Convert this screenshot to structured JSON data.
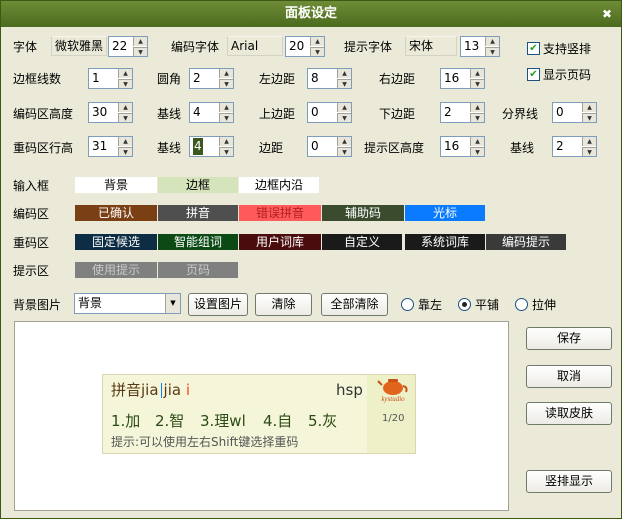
{
  "window": {
    "title": "面板设定"
  },
  "row1": {
    "font_label": "字体",
    "font_value": "微软雅黑",
    "font_size": "22",
    "code_font_label": "编码字体",
    "code_font_value": "Arial",
    "code_font_size": "20",
    "tip_font_label": "提示字体",
    "tip_font_value": "宋体",
    "tip_font_size": "13",
    "vertical_label": "支持竖排",
    "pagenum_label": "显示页码"
  },
  "row2": {
    "border_lines_label": "边框线数",
    "border_lines": "1",
    "corner_label": "圆角",
    "corner": "2",
    "left_margin_label": "左边距",
    "left_margin": "8",
    "right_margin_label": "右边距",
    "right_margin": "16"
  },
  "row3": {
    "code_height_label": "编码区高度",
    "code_height": "30",
    "baseline_label": "基线",
    "baseline": "4",
    "top_margin_label": "上边距",
    "top_margin": "0",
    "bottom_margin_label": "下边距",
    "bottom_margin": "2",
    "divider_label": "分界线",
    "divider": "0"
  },
  "row4": {
    "cand_row_height_label": "重码区行高",
    "cand_row_height": "31",
    "baseline_label": "基线",
    "baseline": "4",
    "margin_label": "边距",
    "margin": "0",
    "tip_height_label": "提示区高度",
    "tip_height": "16",
    "tip_baseline_label": "基线",
    "tip_baseline": "2"
  },
  "colors": {
    "input_label": "输入框",
    "input": [
      "背景",
      "边框",
      "边框内沿"
    ],
    "code_label": "编码区",
    "code": [
      "已确认",
      "拼音",
      "错误拼音",
      "辅助码",
      "光标"
    ],
    "cand_label": "重码区",
    "cand": [
      "固定候选",
      "智能组词",
      "用户词库",
      "自定义",
      "系统词库",
      "编码提示"
    ],
    "tip_label": "提示区",
    "tip": [
      "使用提示",
      "页码"
    ],
    "swatch_colors": {
      "input": [
        "#ffffff",
        "#d6e4bc",
        "#ffffff"
      ],
      "code": [
        "#7a3f14",
        "#4f4f4f",
        "#ff5a5a",
        "#3a4b2e",
        "#0a7bff"
      ],
      "cand": [
        "#0c2d44",
        "#0c4a15",
        "#4a0c0c",
        "#1a1a1a",
        "#1a1a1a",
        "#3a3a3a"
      ],
      "tip": [
        "#808080",
        "#808080"
      ]
    }
  },
  "background": {
    "label": "背景图片",
    "value": "背景",
    "set_image": "设置图片",
    "clear": "清除",
    "clear_all": "全部清除",
    "align_left": "靠左",
    "tile": "平铺",
    "stretch": "拉伸"
  },
  "buttons": {
    "save": "保存",
    "cancel": "取消",
    "load_skin": "读取皮肤",
    "vertical_display": "竖排显示"
  },
  "preview": {
    "composition": "拼音jia",
    "composition_typed": "jia ",
    "composition_error": "i",
    "engine": "hsp",
    "logo_text": "kystudio",
    "candidates": [
      "1.加",
      "2.智",
      "3.理wl",
      "4.自",
      "5.灰"
    ],
    "page": "1/20",
    "hint": "提示:可以使用左右Shift键选择重码"
  }
}
